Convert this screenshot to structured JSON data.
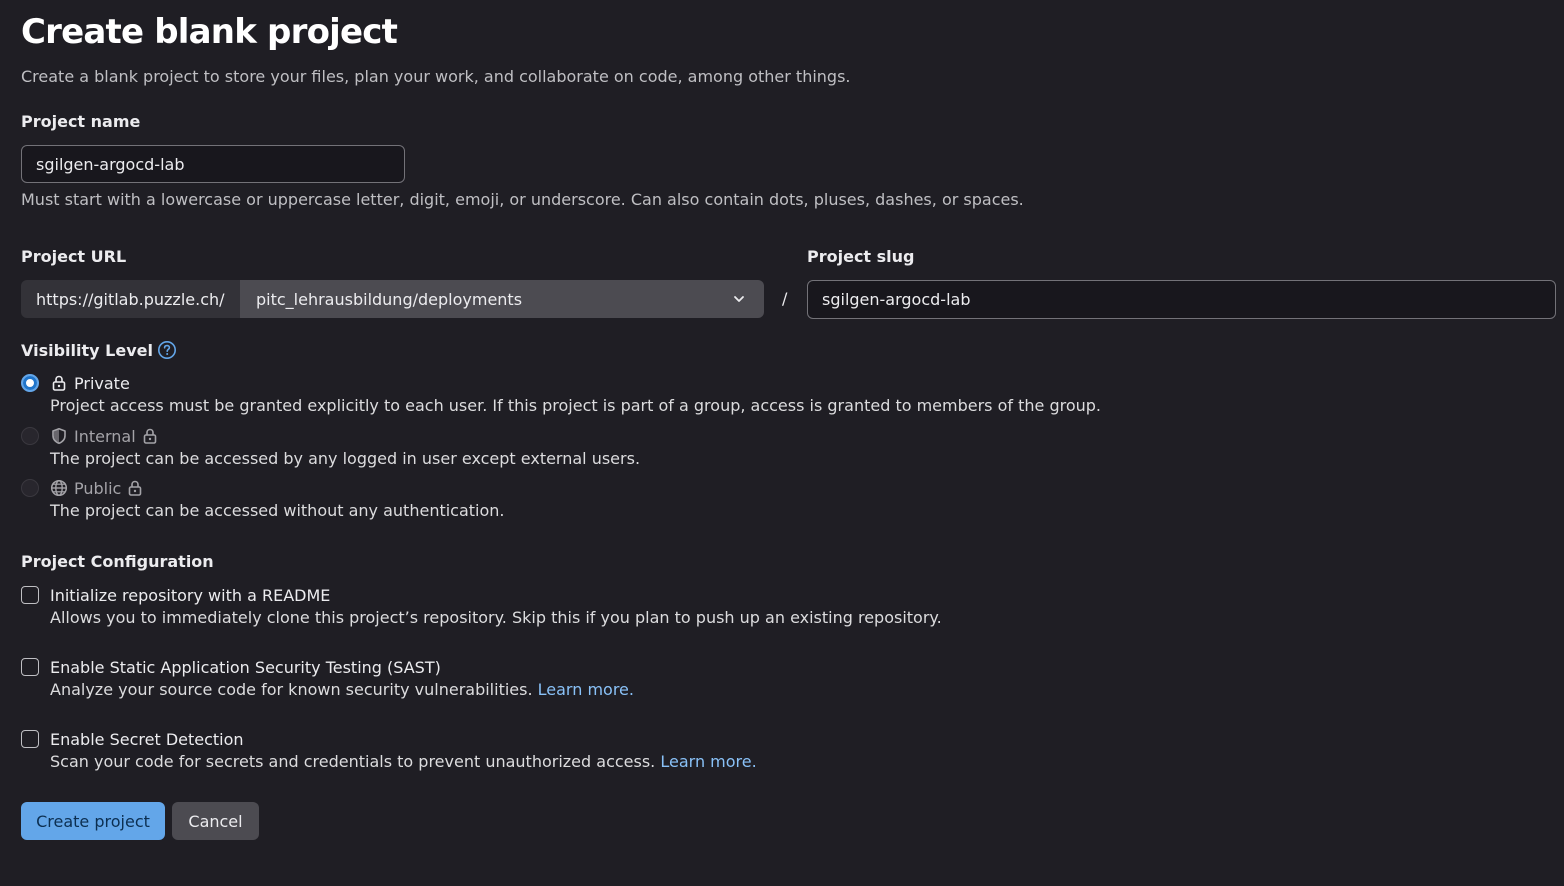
{
  "header": {
    "title": "Create blank project",
    "subtitle": "Create a blank project to store your files, plan your work, and collaborate on code, among other things."
  },
  "project_name": {
    "label": "Project name",
    "value": "sgilgen-argocd-lab",
    "help": "Must start with a lowercase or uppercase letter, digit, emoji, or underscore. Can also contain dots, pluses, dashes, or spaces."
  },
  "project_url": {
    "label": "Project URL",
    "prefix": "https://gitlab.puzzle.ch/",
    "namespace": "pitc_lehrausbildung/deployments",
    "separator": "/"
  },
  "project_slug": {
    "label": "Project slug",
    "value": "sgilgen-argocd-lab"
  },
  "visibility": {
    "label": "Visibility Level",
    "options": [
      {
        "label": "Private",
        "icon": "lock-icon",
        "description": "Project access must be granted explicitly to each user. If this project is part of a group, access is granted to members of the group.",
        "checked": true,
        "disabled": false
      },
      {
        "label": "Internal",
        "icon": "shield-icon",
        "description": "The project can be accessed by any logged in user except external users.",
        "checked": false,
        "disabled": true
      },
      {
        "label": "Public",
        "icon": "globe-icon",
        "description": "The project can be accessed without any authentication.",
        "checked": false,
        "disabled": true
      }
    ]
  },
  "configuration": {
    "label": "Project Configuration",
    "options": [
      {
        "label": "Initialize repository with a README",
        "description": "Allows you to immediately clone this project’s repository. Skip this if you plan to push up an existing repository.",
        "link": ""
      },
      {
        "label": "Enable Static Application Security Testing (SAST)",
        "description": "Analyze your source code for known security vulnerabilities.",
        "link": "Learn more."
      },
      {
        "label": "Enable Secret Detection",
        "description": "Scan your code for secrets and credentials to prevent unauthorized access.",
        "link": "Learn more."
      }
    ]
  },
  "actions": {
    "create_label": "Create project",
    "cancel_label": "Cancel"
  },
  "colors": {
    "background": "#1f1e24",
    "primary": "#63a6e9",
    "link": "#89c1f7"
  }
}
